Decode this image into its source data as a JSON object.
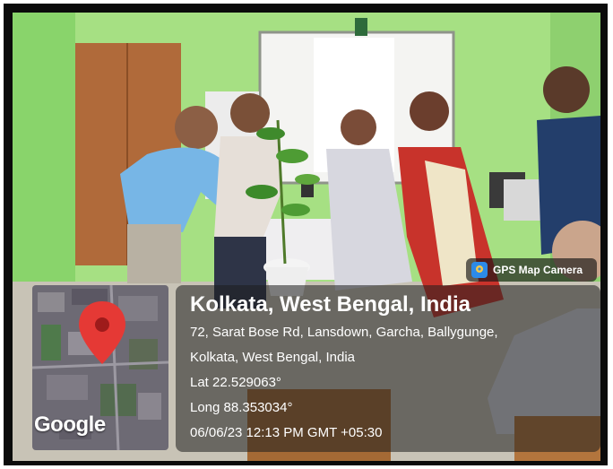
{
  "overlay": {
    "app_badge": "GPS Map Camera",
    "place": "Kolkata, West Bengal, India",
    "address_line1": "72, Sarat Bose Rd, Lansdown, Garcha, Ballygunge,",
    "address_line2": "Kolkata, West Bengal, India",
    "lat": "Lat 22.529063°",
    "long": "Long 88.353034°",
    "datetime": "06/06/23 12:13 PM GMT +05:30"
  },
  "map": {
    "provider_logo": "Google",
    "pin_color": "#e53935"
  },
  "icons": {
    "badge_icon": "camera-pin-icon",
    "map_pin": "location-pin-icon"
  },
  "colors": {
    "wall": "#9ddc7a",
    "panel": "#ffffff"
  }
}
